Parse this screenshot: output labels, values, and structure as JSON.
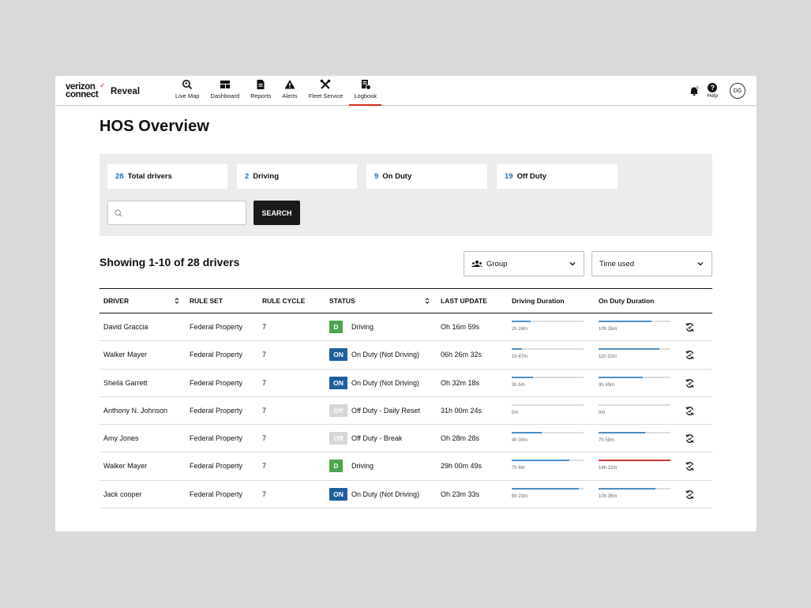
{
  "brand": {
    "line1": "verizon",
    "line2": "connect",
    "product": "Reveal"
  },
  "nav": [
    {
      "label": "Live Map",
      "icon": "live-map-icon",
      "active": false
    },
    {
      "label": "Dashboard",
      "icon": "dashboard-icon",
      "active": false
    },
    {
      "label": "Reports",
      "icon": "reports-icon",
      "active": false
    },
    {
      "label": "Alerts",
      "icon": "alerts-icon",
      "active": false
    },
    {
      "label": "Fleet Service",
      "icon": "fleet-service-icon",
      "active": false
    },
    {
      "label": "Logbook",
      "icon": "logbook-icon",
      "active": true
    }
  ],
  "header_tools": {
    "help_label": "Help",
    "avatar_initials": "DG"
  },
  "page": {
    "title": "HOS Overview"
  },
  "summary": {
    "stats": [
      {
        "num": "28",
        "label": "Total drivers"
      },
      {
        "num": "2",
        "label": "Driving"
      },
      {
        "num": "9",
        "label": "On Duty"
      },
      {
        "num": "19",
        "label": "Off Duty"
      }
    ],
    "search_placeholder": "",
    "search_button": "SEARCH"
  },
  "list": {
    "showing": "Showing 1-10 of 28 drivers",
    "group_label": "Group",
    "time_label": "Time used"
  },
  "table": {
    "headers": [
      "DRIVER",
      "RULE SET",
      "RULE CYCLE",
      "STATUS",
      "LAST UPDATE",
      "Driving Duration",
      "On Duty Duration"
    ],
    "rows": [
      {
        "driver": "David Graccia",
        "rule_set": "Federal Property",
        "cycle": "7",
        "badge": "D",
        "badge_type": "d",
        "status": "Driving",
        "last_update": "Oh 16m 59s",
        "driving": "2h 24m",
        "driving_pct": 0.26,
        "on_duty": "10h 35m",
        "on_duty_pct": 0.74,
        "on_duty_over": false
      },
      {
        "driver": "Walker Mayer",
        "rule_set": "Federal Property",
        "cycle": "7",
        "badge": "ON",
        "badge_type": "on",
        "status": "On Duty (Not Driving)",
        "last_update": "06h 26m 32s",
        "driving": "1h 47m",
        "driving_pct": 0.14,
        "on_duty": "11h 32m",
        "on_duty_pct": 0.85,
        "on_duty_over": false
      },
      {
        "driver": "Sheila Garrett",
        "rule_set": "Federal Property",
        "cycle": "7",
        "badge": "ON",
        "badge_type": "on",
        "status": "On Duty (Not Driving)",
        "last_update": "Oh 32m 18s",
        "driving": "3h 5m",
        "driving_pct": 0.3,
        "on_duty": "9h 45m",
        "on_duty_pct": 0.61,
        "on_duty_over": false
      },
      {
        "driver": "Anthony N. Johnson",
        "rule_set": "Federal Property",
        "cycle": "7",
        "badge": "Off",
        "badge_type": "off",
        "status": "Off Duty - Daily Reset",
        "last_update": "31h 00m 24s",
        "driving": "0m",
        "driving_pct": 0,
        "on_duty": "0m",
        "on_duty_pct": 0,
        "on_duty_over": false
      },
      {
        "driver": "Amy Jones",
        "rule_set": "Federal Property",
        "cycle": "7",
        "badge": "Off",
        "badge_type": "off",
        "status": "Off Duty - Break",
        "last_update": "Oh 28m 28s",
        "driving": "4h 00m",
        "driving_pct": 0.42,
        "on_duty": "7h 59m",
        "on_duty_pct": 0.65,
        "on_duty_over": false
      },
      {
        "driver": "Walker Mayer",
        "rule_set": "Federal Property",
        "cycle": "7",
        "badge": "D",
        "badge_type": "d",
        "status": "Driving",
        "last_update": "29h 00m 49s",
        "driving": "7h 6m",
        "driving_pct": 0.8,
        "on_duty": "14h 12m",
        "on_duty_pct": 1.0,
        "on_duty_over": true
      },
      {
        "driver": "Jack cooper",
        "rule_set": "Federal Property",
        "cycle": "7",
        "badge": "ON",
        "badge_type": "on",
        "status": "On Duty (Not Driving)",
        "last_update": "Oh 23m 33s",
        "driving": "8h 23m",
        "driving_pct": 0.93,
        "on_duty": "10h 36m",
        "on_duty_pct": 0.79,
        "on_duty_over": false
      }
    ]
  },
  "colors": {
    "accent_red": "#d52b1e",
    "blue": "#1f6fb5",
    "bar_blue": "#4a90c8",
    "driving_green": "#4ea54e",
    "on_duty_blue": "#1e5f9d",
    "off_gray": "#d6d6d6",
    "over_red": "#c0392b"
  }
}
